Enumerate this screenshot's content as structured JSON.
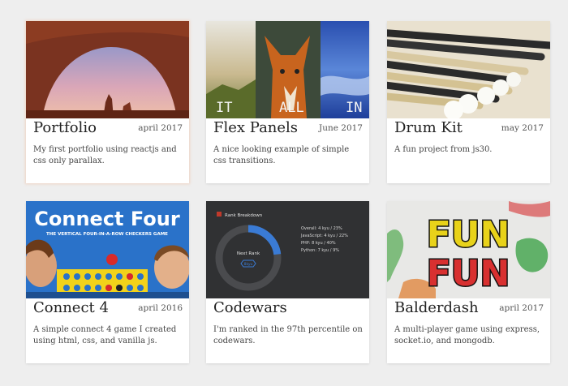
{
  "projects": [
    {
      "title": "Portfolio",
      "date": "april 2017",
      "description": "My first portfolio using reactjs and css only parallax."
    },
    {
      "title": "Flex Panels",
      "date": "June 2017",
      "description": "A nice looking example of simple css transitions.",
      "panel_labels": [
        "IT",
        "ALL",
        "IN"
      ]
    },
    {
      "title": "Drum Kit",
      "date": "may 2017",
      "description": "A fun project from js30."
    },
    {
      "title": "Connect 4",
      "date": "april 2016",
      "description": "A simple connect 4 game I created using html, css, and vanilla js.",
      "box_title": "Connect Four",
      "box_subtitle": "THE VERTICAL FOUR-IN-A-ROW CHECKERS GAME"
    },
    {
      "title": "Codewars",
      "date": "",
      "description": "I'm ranked in the 97th percentile on codewars.",
      "widget": {
        "heading": "Rank Breakdown",
        "center_label": "Next Rank",
        "badge": "8kyu",
        "stats": [
          "Overall: 4 kyu / 23%",
          "JavaScript: 4 kyu / 22%",
          "PHP: 8 kyu / 40%",
          "Python: 7 kyu / 9%"
        ],
        "progress_fraction": 0.23
      }
    },
    {
      "title": "Balderdash",
      "date": "april 2017",
      "description": "A multi-player game using express, socket.io, and mongodb.",
      "art_text": [
        "FUN",
        "FUN"
      ]
    }
  ],
  "colors": {
    "page_background": "#eeeeee",
    "card_background": "#ffffff",
    "codewars_accent": "#3a7bd5",
    "codewars_badge_red": "#c0392b"
  }
}
